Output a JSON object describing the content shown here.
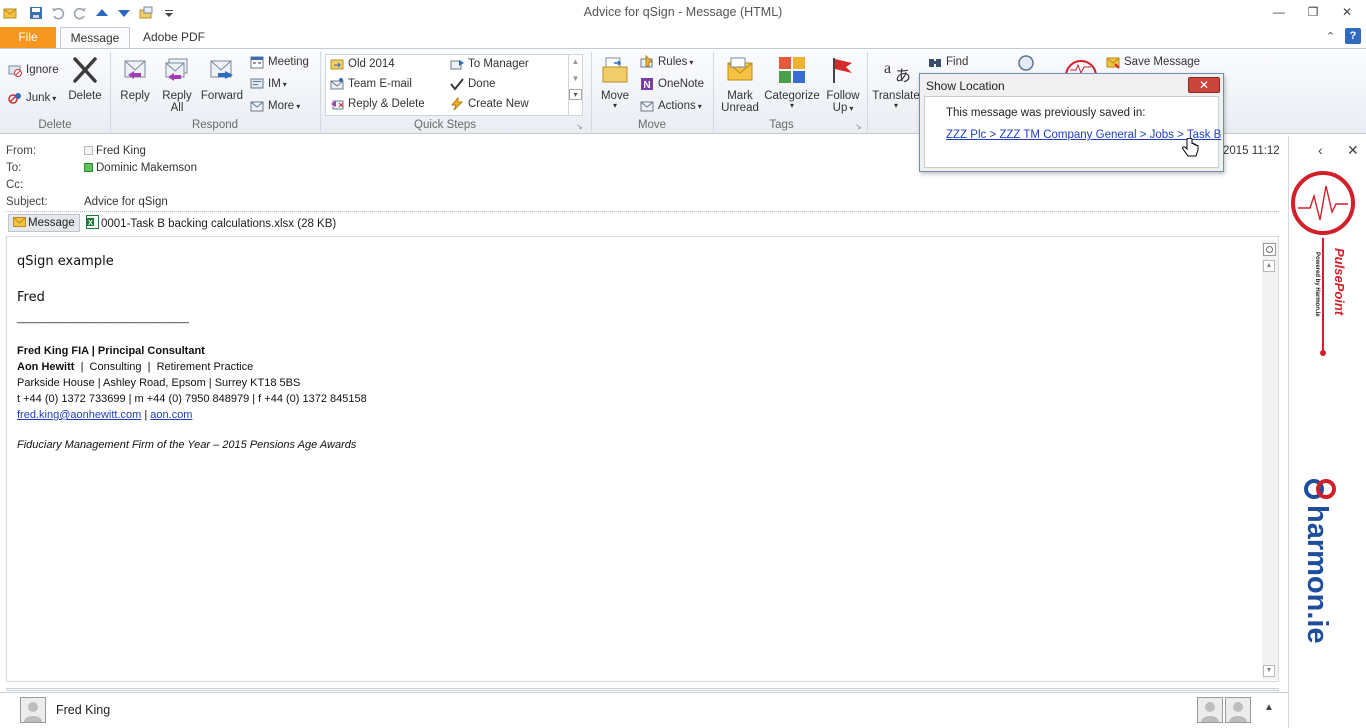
{
  "window": {
    "title": "Advice for qSign  -  Message (HTML)"
  },
  "tabs": {
    "file": "File",
    "message": "Message",
    "adobe": "Adobe PDF"
  },
  "ribbon": {
    "delete_group": {
      "label": "Delete",
      "ignore": "Ignore",
      "junk": "Junk",
      "delete": "Delete"
    },
    "respond_group": {
      "label": "Respond",
      "reply": "Reply",
      "reply_all_1": "Reply",
      "reply_all_2": "All",
      "forward": "Forward",
      "meeting": "Meeting",
      "im": "IM",
      "more": "More"
    },
    "quicksteps_group": {
      "label": "Quick Steps",
      "items": [
        "Old 2014",
        "Team E-mail",
        "Reply & Delete",
        "To Manager",
        "Done",
        "Create New"
      ]
    },
    "move_group": {
      "label": "Move",
      "move": "Move",
      "rules": "Rules",
      "onenote": "OneNote",
      "actions": "Actions"
    },
    "tags_group": {
      "label": "Tags",
      "mark_unread_1": "Mark",
      "mark_unread_2": "Unread",
      "categorize": "Categorize",
      "follow_up_1": "Follow",
      "follow_up_2": "Up"
    },
    "translate": "Translate",
    "find": "Find",
    "save_message": "Save Message"
  },
  "header": {
    "from_label": "From:",
    "from_value": "Fred King",
    "to_label": "To:",
    "to_value": "Dominic Makemson",
    "cc_label": "Cc:",
    "subject_label": "Subject:",
    "subject_value": "Advice for qSign",
    "sent_partial": "2015 11:12"
  },
  "attachments": {
    "message_tab": "Message",
    "file": "0001-Task B backing calculations.xlsx (28 KB)"
  },
  "body": {
    "line1": "qSign example",
    "line2": "Fred",
    "rule": "_____________________________",
    "sig_name": "Fred King FIA  |  Principal Consultant",
    "sig_company_bold": "Aon Hewitt",
    "sig_company_rest": "  |  Consulting  |  Retirement Practice",
    "sig_address": "Parkside House  |  Ashley Road, Epsom  |  Surrey KT18 5BS",
    "sig_phones": "t  +44 (0) 1372 733699  |  m  +44 (0) 7950 848979  |  f  +44 (0) 1372 845158",
    "sig_email": "fred.king@aonhewitt.com",
    "sig_sep": " | ",
    "sig_web": "aon.com",
    "sig_award": "Fiduciary Management Firm of the Year – 2015 Pensions Age Awards"
  },
  "popup": {
    "title": "Show Location",
    "close": "✕",
    "text": "This message was previously saved in:",
    "link": "ZZZ Plc > ZZZ TM Company General > Jobs > Task B"
  },
  "sidepanel": {
    "pulsepoint": "PulsePoint",
    "powered": "Powered by Harmon.ie",
    "harmonie": "harmon.ie"
  },
  "footer": {
    "person": "Fred King"
  },
  "colors": {
    "file_tab": "#f6961f",
    "link": "#1f3fbf",
    "pulse_red": "#d21f2a",
    "harmonie_blue": "#1f4f9c"
  }
}
